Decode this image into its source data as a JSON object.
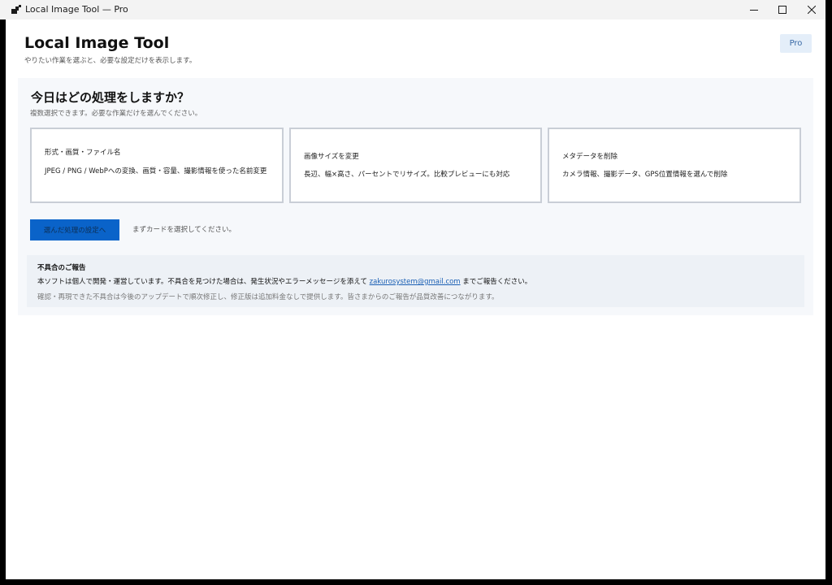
{
  "window": {
    "title": "Local Image Tool — Pro",
    "icon": "app-icon"
  },
  "header": {
    "title": "Local Image Tool",
    "subtitle": "やりたい作業を選ぶと、必要な設定だけを表示します。",
    "badge": "Pro"
  },
  "panel": {
    "question": "今日はどの処理をしますか？",
    "question_sub": "複数選択できます。必要な作業だけを選んでください。",
    "cards": [
      {
        "title": "形式・画質・ファイル名",
        "description": "JPEG / PNG / WebPへの変換、画質・容量、撮影情報を使った名前変更"
      },
      {
        "title": "画像サイズを変更",
        "description": "長辺、幅×高さ、パーセントでリサイズ。比較プレビューにも対応"
      },
      {
        "title": "メタデータを削除",
        "description": "カメラ情報、撮影データ、GPS位置情報を選んで削除"
      }
    ],
    "primary_button": "選んだ処理の設定へ",
    "hint": "まずカードを選択してください。"
  },
  "report": {
    "title": "不具合のご報告",
    "line_prefix": "本ソフトは個人で開発・運営しています。不具合を見つけた場合は、発生状況やエラーメッセージを添えて ",
    "email": "zakurosystem@gmail.com",
    "line_suffix": " までご報告ください。",
    "note": "確認・再現できた不具合は今後のアップデートで順次修正し、修正版は追加料金なしで提供します。皆さまからのご報告が品質改善につながります。"
  },
  "colors": {
    "accent": "#0a63c9",
    "panel_bg": "#f6f8fb",
    "report_bg": "#edf1f6",
    "badge_bg": "#e4eef9"
  }
}
